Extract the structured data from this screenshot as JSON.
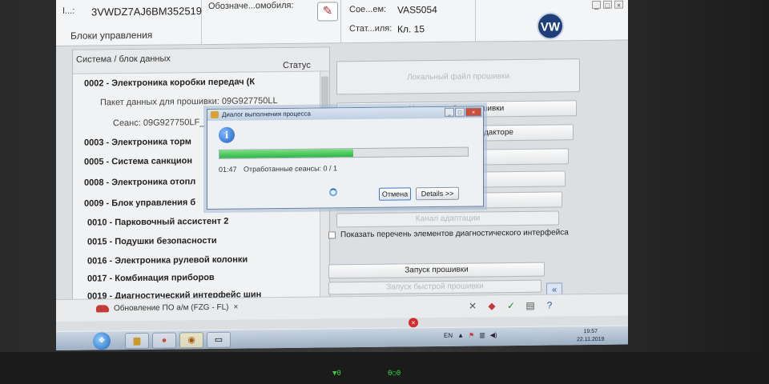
{
  "header": {
    "vin_label": "I...:",
    "vin_value": "3VWDZ7AJ6BM352519",
    "vehicle_label": "Обозначе...омобиля:",
    "connection_label": "Сое...ем:",
    "connection_value": "VAS5054",
    "status_label": "Стат...иля:",
    "status_value": "Кл. 15"
  },
  "window_controls": {
    "minimize": "_",
    "maximize": "□",
    "close": "×"
  },
  "section_title": "Блоки управления",
  "tree": {
    "col_system": "Система / блок данных",
    "col_status": "Статус",
    "rows": [
      {
        "text": "0002 - Электроника коробки передач  (К",
        "kind": "bold"
      },
      {
        "text": "Пакет данных для прошивки: 09G927750LL",
        "kind": "sub"
      },
      {
        "text": "Сеанс: 09G927750LF_",
        "kind": "sub"
      },
      {
        "text": "0003 - Электроника торм",
        "kind": "bold"
      },
      {
        "text": "0005 - Система санкцион",
        "kind": "bold"
      },
      {
        "text": "0008 - Электроника отопл",
        "kind": "bold"
      },
      {
        "text": "0009 - Блок управления б",
        "kind": "bold"
      },
      {
        "text": "0010 - Парковочный ассистент 2",
        "kind": "bold"
      },
      {
        "text": "0015 - Подушки безопасности",
        "kind": "bold"
      },
      {
        "text": "0016 - Электроника рулевой колонки",
        "kind": "bold"
      },
      {
        "text": "0017 - Комбинация приборов",
        "kind": "bold"
      },
      {
        "text": "0019 - Диагностический интерфейс шин",
        "kind": "bold"
      }
    ]
  },
  "right_panel": {
    "local_file_button": "Локальный файл прошивки",
    "delete_selection_button": "Удалить выбор прошивки",
    "editor_button_fragment": "дакторе",
    "adaptation_channel_button": "Канал адаптации",
    "show_interface_checkbox": "Показать перечень элементов диагностического интерфейса",
    "start_flash_button": "Запуск прошивки",
    "start_fast_flash_button": "Запуск быстрой прошивки",
    "expander": "«"
  },
  "status_bar": {
    "tab_label": "Обновление ПО а/м (FZG - FL)",
    "tab_close": "×"
  },
  "taskbar": {
    "time": "19:57",
    "date": "22.11.2019",
    "lang": "EN"
  },
  "dialog": {
    "title": "Диалог выполнения процесса",
    "elapsed": "01:47",
    "sessions_text": "Отработанные сеансы: 0 / 1",
    "progress_fraction": 0.54,
    "cancel_button": "Отмена",
    "details_button": "Details >>"
  },
  "leds": {
    "left": "▼0",
    "right": "0○0"
  },
  "colors": {
    "progress_green": "#2db54a",
    "vw_blue": "#1f3e7a",
    "error_red": "#d22d2d"
  }
}
